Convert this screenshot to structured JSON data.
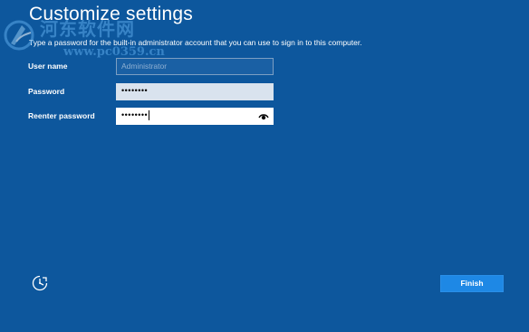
{
  "page": {
    "title": "Customize settings",
    "description": "Type a password for the built-in administrator account that you can use to sign in to this computer."
  },
  "form": {
    "username": {
      "label": "User name",
      "placeholder": "Administrator",
      "value": ""
    },
    "password": {
      "label": "Password",
      "masked_value": "••••••••"
    },
    "reenter_password": {
      "label": "Reenter password",
      "masked_value": "••••••••",
      "reveal_icon": "eye-icon"
    }
  },
  "watermark": {
    "text": "河东软件网",
    "url": "www.pc0359.cn",
    "logo_icon": "watermark-logo"
  },
  "footer": {
    "ease_of_access_icon": "ease-of-access-icon",
    "finish_label": "Finish"
  },
  "colors": {
    "background": "#0d579d",
    "accent_button": "#1e88e5",
    "text": "#ffffff",
    "watermark": "#5aa8e8"
  }
}
